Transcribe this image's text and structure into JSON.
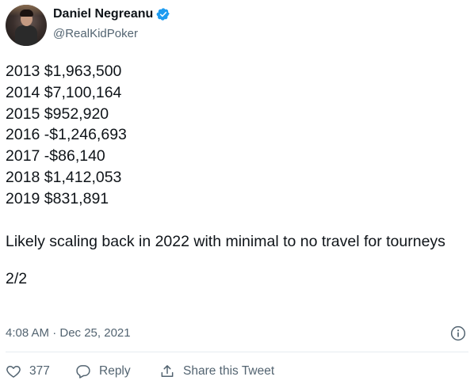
{
  "author": {
    "name": "Daniel Negreanu",
    "handle": "@RealKidPoker",
    "verified": true
  },
  "tweet": {
    "earnings": [
      "2013 $1,963,500",
      "2014 $7,100,164",
      "2015 $952,920",
      "2016 -$1,246,693",
      "2017 -$86,140",
      "2018 $1,412,053",
      "2019 $831,891"
    ],
    "message": "Likely scaling back in 2022 with minimal to no travel for tourneys",
    "thread_position": "2/2",
    "timestamp": "4:08 AM · Dec 25, 2021"
  },
  "actions": {
    "like_count": "377",
    "reply_label": "Reply",
    "share_label": "Share this Tweet"
  },
  "icons": {
    "verified": "verified-badge-icon",
    "info": "info-icon",
    "like": "heart-icon",
    "reply": "reply-bubble-icon",
    "share": "share-upload-icon"
  },
  "colors": {
    "text": "#0f1419",
    "secondary": "#536471",
    "verified_badge": "#1d9bf0",
    "divider": "#e6ecf0"
  }
}
